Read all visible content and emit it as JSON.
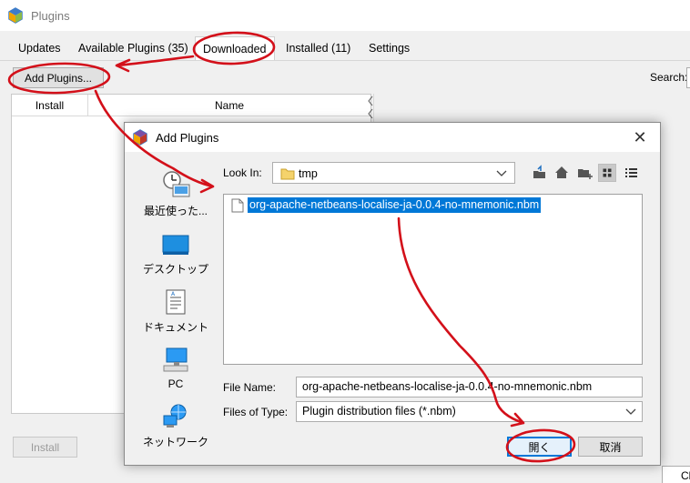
{
  "window": {
    "title": "Plugins"
  },
  "tabs": [
    {
      "label": "Updates"
    },
    {
      "label": "Available Plugins (35)"
    },
    {
      "label": "Downloaded"
    },
    {
      "label": "Installed (11)"
    },
    {
      "label": "Settings"
    }
  ],
  "toolbar": {
    "add_plugins": "Add Plugins...",
    "search_label": "Search:"
  },
  "table": {
    "columns": [
      "Install",
      "Name"
    ]
  },
  "footer": {
    "install": "Install",
    "corner_button": "Cl"
  },
  "dialog": {
    "title": "Add Plugins",
    "places": [
      {
        "label": "最近使った..."
      },
      {
        "label": "デスクトップ"
      },
      {
        "label": "ドキュメント"
      },
      {
        "label": "PC"
      },
      {
        "label": "ネットワーク"
      }
    ],
    "look_in_label": "Look In:",
    "look_in_value": "tmp",
    "files": [
      "org-apache-netbeans-localise-ja-0.0.4-no-mnemonic.nbm"
    ],
    "file_name_label": "File Name:",
    "file_name_value": "org-apache-netbeans-localise-ja-0.0.4-no-mnemonic.nbm",
    "files_of_type_label": "Files of Type:",
    "files_of_type_value": "Plugin distribution files (*.nbm)",
    "open": "開く",
    "cancel": "取消"
  },
  "colors": {
    "selection": "#0078d7",
    "annotation": "#d3101a"
  }
}
